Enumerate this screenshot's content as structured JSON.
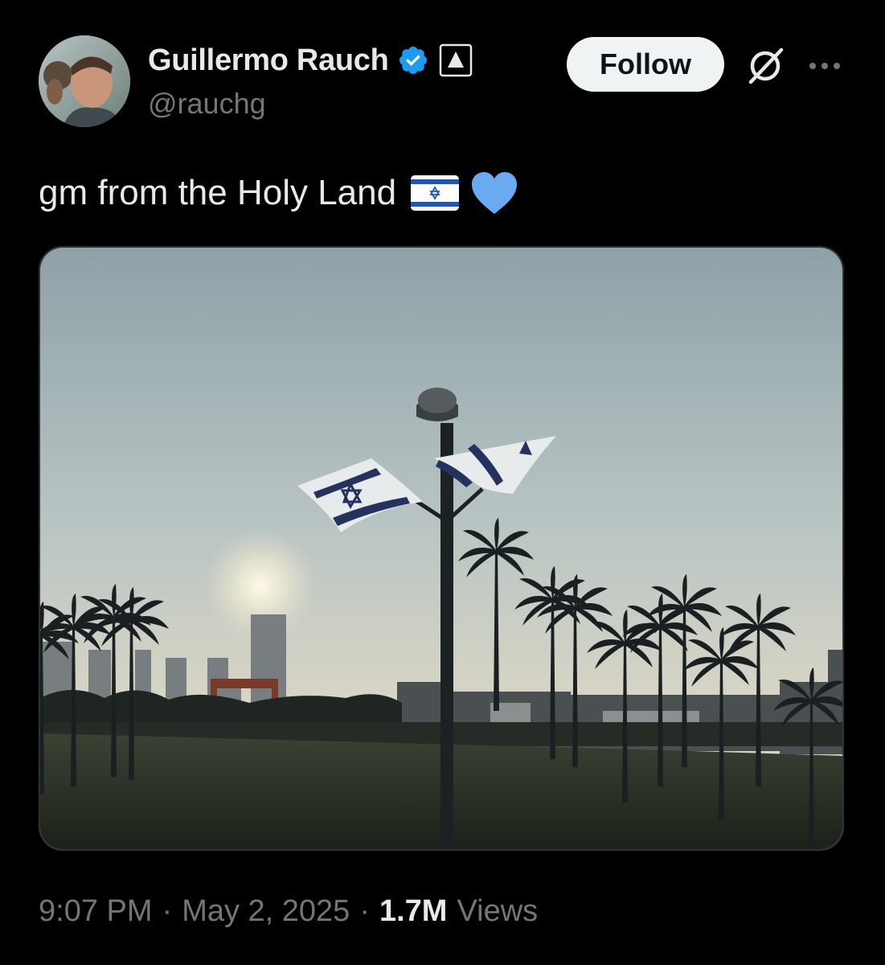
{
  "author": {
    "display_name": "Guillermo Rauch",
    "handle": "@rauchg",
    "verified": true
  },
  "actions": {
    "follow_label": "Follow",
    "grok_icon": "grok-icon",
    "more_icon": "more-horizontal-icon"
  },
  "tweet": {
    "text": "gm from the Holy Land",
    "emojis": [
      "israel-flag",
      "blue-heart"
    ]
  },
  "meta": {
    "time": "9:07 PM",
    "separator": "·",
    "date": "May 2, 2025",
    "views_count": "1.7M",
    "views_label": "Views"
  },
  "colors": {
    "background": "#000000",
    "text_primary": "#e7e9ea",
    "text_secondary": "#71767b",
    "verified_blue": "#1d9bf0",
    "heart_blue": "#6aaaf0",
    "border": "#2f3336"
  }
}
